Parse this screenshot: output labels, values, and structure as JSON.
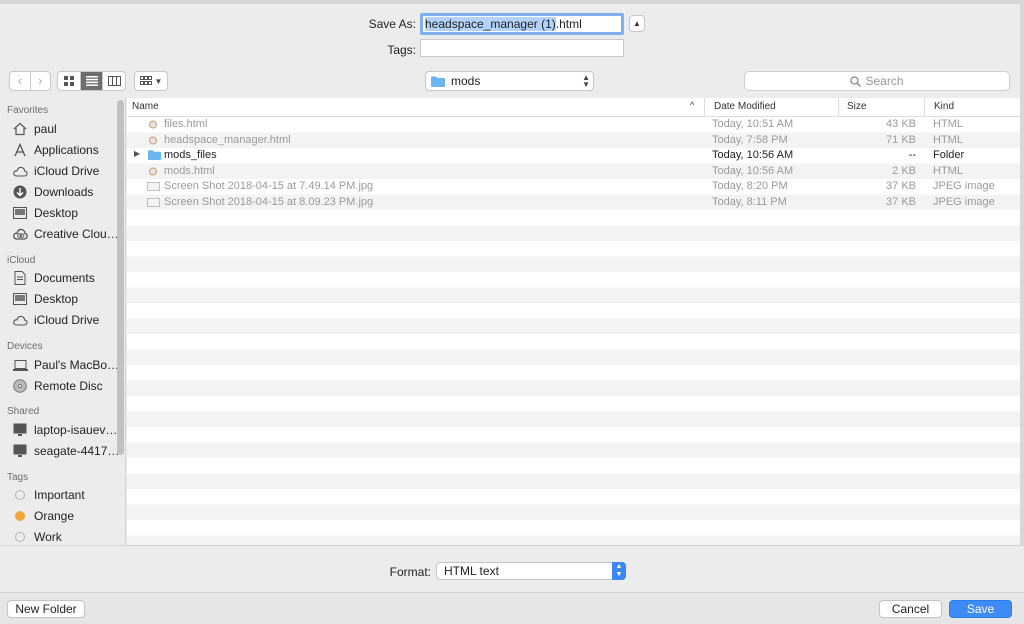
{
  "save_as": {
    "label": "Save As:",
    "filename_selected": "headspace_manager (1)",
    "filename_extension": ".html",
    "tags_label": "Tags:",
    "tags_value": ""
  },
  "toolbar": {
    "back_icon": "chevron-left-icon",
    "forward_icon": "chevron-right-icon",
    "view_modes": [
      "icon-view",
      "list-view",
      "column-view"
    ],
    "active_view": "list-view",
    "location": "mods",
    "search_placeholder": "Search"
  },
  "sidebar": {
    "sections": [
      {
        "title": "Favorites",
        "items": [
          {
            "label": "paul",
            "icon": "home-icon"
          },
          {
            "label": "Applications",
            "icon": "applications-icon"
          },
          {
            "label": "iCloud Drive",
            "icon": "cloud-icon"
          },
          {
            "label": "Downloads",
            "icon": "download-icon"
          },
          {
            "label": "Desktop",
            "icon": "desktop-icon"
          },
          {
            "label": "Creative Clou…",
            "icon": "creative-cloud-icon"
          }
        ]
      },
      {
        "title": "iCloud",
        "items": [
          {
            "label": "Documents",
            "icon": "document-icon"
          },
          {
            "label": "Desktop",
            "icon": "desktop-icon"
          },
          {
            "label": "iCloud Drive",
            "icon": "cloud-icon"
          }
        ]
      },
      {
        "title": "Devices",
        "items": [
          {
            "label": "Paul's MacBo…",
            "icon": "laptop-icon"
          },
          {
            "label": "Remote Disc",
            "icon": "disc-icon"
          }
        ]
      },
      {
        "title": "Shared",
        "items": [
          {
            "label": "laptop-isauev…",
            "icon": "monitor-icon"
          },
          {
            "label": "seagate-4417…",
            "icon": "monitor-icon"
          }
        ]
      },
      {
        "title": "Tags",
        "items": [
          {
            "label": "Important",
            "icon": "tag-dot-icon",
            "color": "#ececec"
          },
          {
            "label": "Orange",
            "icon": "tag-dot-icon",
            "color": "#f5a53a"
          },
          {
            "label": "Work",
            "icon": "tag-dot-icon",
            "color": "#ececec"
          }
        ]
      }
    ]
  },
  "columns": {
    "name": "Name",
    "date": "Date Modified",
    "size": "Size",
    "kind": "Kind"
  },
  "files": [
    {
      "name": "files.html",
      "date": "Today, 10:51 AM",
      "size": "43 KB",
      "kind": "HTML",
      "type": "html"
    },
    {
      "name": "headspace_manager.html",
      "date": "Today, 7:58 PM",
      "size": "71 KB",
      "kind": "HTML",
      "type": "html"
    },
    {
      "name": "mods_files",
      "date": "Today, 10:56 AM",
      "size": "--",
      "kind": "Folder",
      "type": "folder"
    },
    {
      "name": "mods.html",
      "date": "Today, 10:56 AM",
      "size": "2 KB",
      "kind": "HTML",
      "type": "html"
    },
    {
      "name": "Screen Shot 2018-04-15 at 7.49.14 PM.jpg",
      "date": "Today, 8:20 PM",
      "size": "37 KB",
      "kind": "JPEG image",
      "type": "image"
    },
    {
      "name": "Screen Shot 2018-04-15 at 8.09.23 PM.jpg",
      "date": "Today, 8:11 PM",
      "size": "37 KB",
      "kind": "JPEG image",
      "type": "image"
    }
  ],
  "format": {
    "label": "Format:",
    "value": "HTML text"
  },
  "buttons": {
    "new_folder": "New Folder",
    "cancel": "Cancel",
    "save": "Save"
  },
  "colors": {
    "accent": "#3d8bf6",
    "selection": "#b3d3fb",
    "folder": "#6bb5f0"
  }
}
